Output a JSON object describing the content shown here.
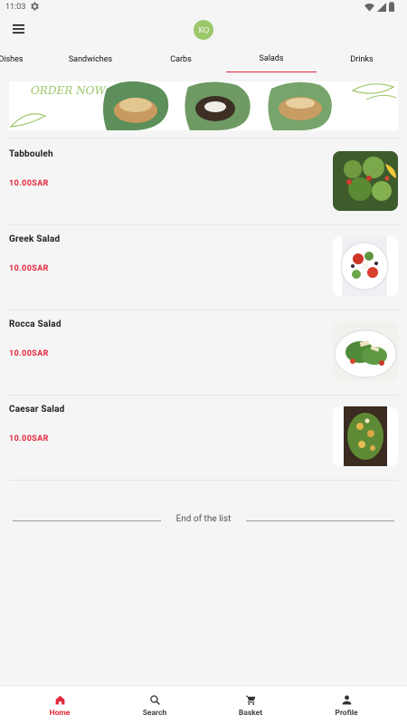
{
  "status_bar": {
    "time": "11:03"
  },
  "app_bar": {
    "logo_text": "KQ"
  },
  "tabs": [
    {
      "label": "Dishes",
      "active": false
    },
    {
      "label": "Sandwiches",
      "active": false
    },
    {
      "label": "Carbs",
      "active": false
    },
    {
      "label": "Salads",
      "active": true
    },
    {
      "label": "Drinks",
      "active": false
    }
  ],
  "banner": {
    "text": "ORDER NOW"
  },
  "items": [
    {
      "name": "Tabbouleh",
      "price": "10.00SAR",
      "image": "tabbouleh-image"
    },
    {
      "name": "Greek Salad",
      "price": "10.00SAR",
      "image": "greek-salad-image"
    },
    {
      "name": "Rocca Salad",
      "price": "10.00SAR",
      "image": "rocca-salad-image"
    },
    {
      "name": "Caesar Salad",
      "price": "10.00SAR",
      "image": "caesar-salad-image"
    }
  ],
  "end_of_list": "End of the list",
  "bottom_nav": [
    {
      "label": "Home",
      "icon": "home-icon",
      "active": true
    },
    {
      "label": "Search",
      "icon": "search-icon",
      "active": false
    },
    {
      "label": "Basket",
      "icon": "cart-icon",
      "active": false
    },
    {
      "label": "Profile",
      "icon": "person-icon",
      "active": false
    }
  ],
  "colors": {
    "accent": "#e3263a",
    "logo_green": "#9cc76b",
    "background": "#f5f5f5"
  }
}
